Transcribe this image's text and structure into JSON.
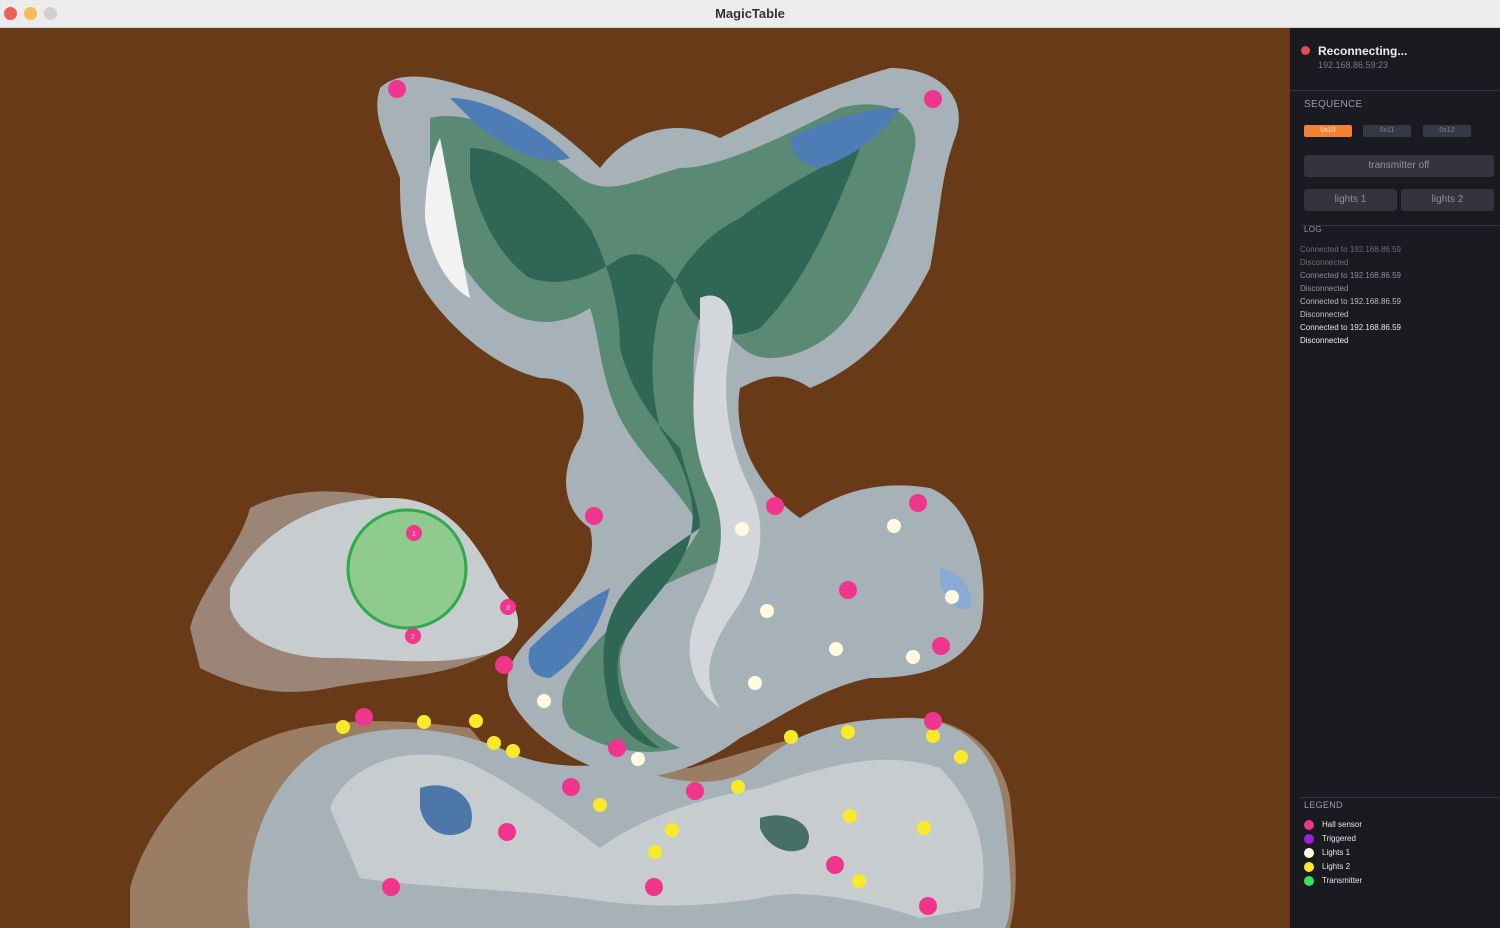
{
  "window": {
    "title": "MagicTable"
  },
  "connection": {
    "status": "Reconnecting...",
    "address": "192.168.86.59:23",
    "status_color": "#e24c58"
  },
  "sequence": {
    "label": "SEQUENCE",
    "items": [
      {
        "label": "0x10",
        "active": true
      },
      {
        "label": "0x11",
        "active": false
      },
      {
        "label": "0x12",
        "active": false
      }
    ],
    "active_color": "#f58232"
  },
  "controls": {
    "transmitter": "transmitter off",
    "lights1": "lights 1",
    "lights2": "lights 2"
  },
  "log": {
    "label": "LOG",
    "lines": [
      "Connected to 192.168.86.59",
      "Disconnected",
      "Connected to 192.168.86.59",
      "Disconnected",
      "Connected to 192.168.86.59",
      "Disconnected",
      "Connected to 192.168.86.59",
      "Disconnected"
    ]
  },
  "legend": {
    "label": "LEGEND",
    "items": [
      {
        "label": "Hall sensor",
        "color": "#f0358c"
      },
      {
        "label": "Triggered",
        "color": "#9b20e6"
      },
      {
        "label": "Lights 1",
        "color": "#fffbe0"
      },
      {
        "label": "Lights 2",
        "color": "#f8ea2a"
      },
      {
        "label": "Transmitter",
        "color": "#35e463"
      }
    ]
  },
  "map": {
    "background_color": "#683a18",
    "numbered_sensor_labels": [
      "1",
      "2",
      "3"
    ],
    "transmitter_color": "#8fcb8f"
  }
}
